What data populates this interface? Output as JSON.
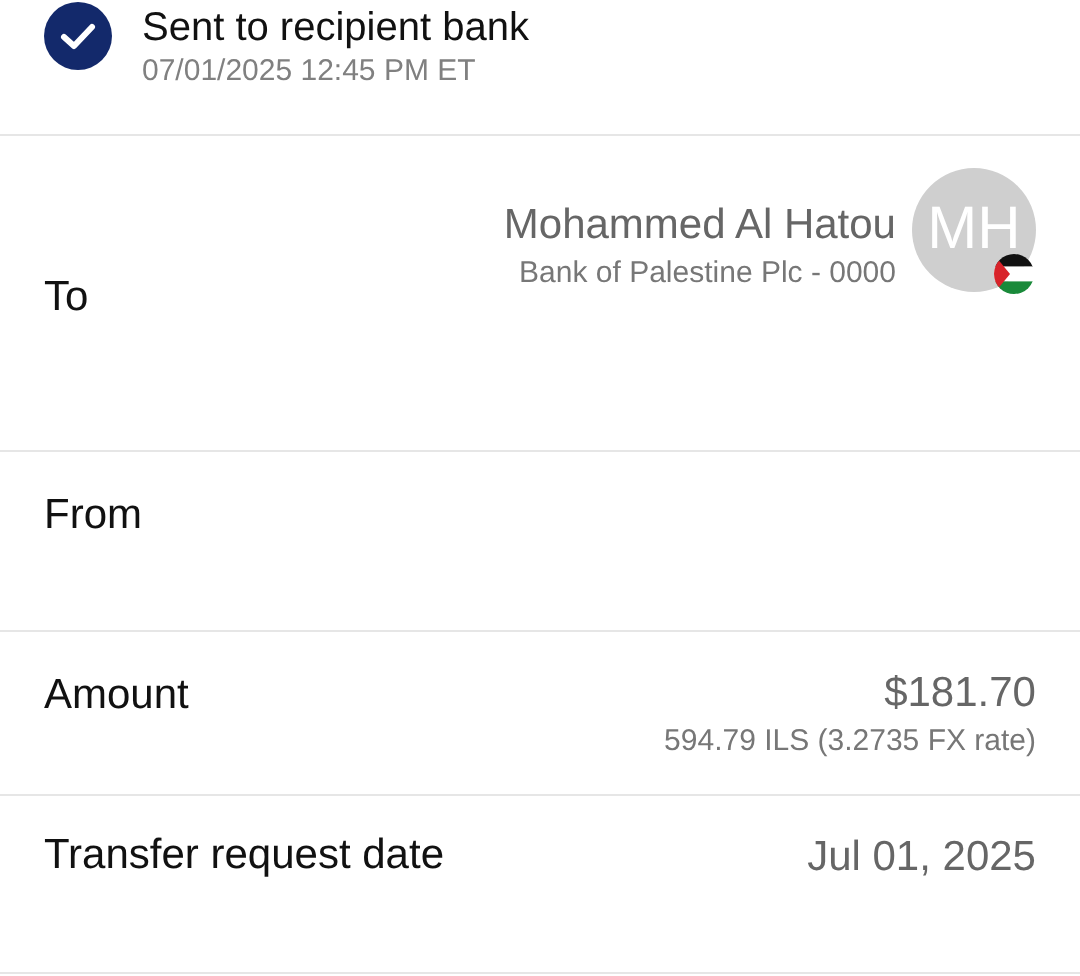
{
  "status": {
    "title": "Sent to recipient bank",
    "timestamp": "07/01/2025 12:45 PM ET"
  },
  "rows": [
    {
      "kind": "recipient",
      "label": "To",
      "name": "Mohammed Al Hatou",
      "bank": "Bank of Palestine Plc - 0000",
      "initials": "MH"
    },
    {
      "kind": "plain",
      "label": "From"
    },
    {
      "kind": "amount",
      "label": "Amount",
      "value": "$181.70",
      "detail": "594.79 ILS (3.2735 FX rate)"
    },
    {
      "kind": "date",
      "label": "Transfer request date",
      "value": "Jul 01, 2025"
    }
  ]
}
